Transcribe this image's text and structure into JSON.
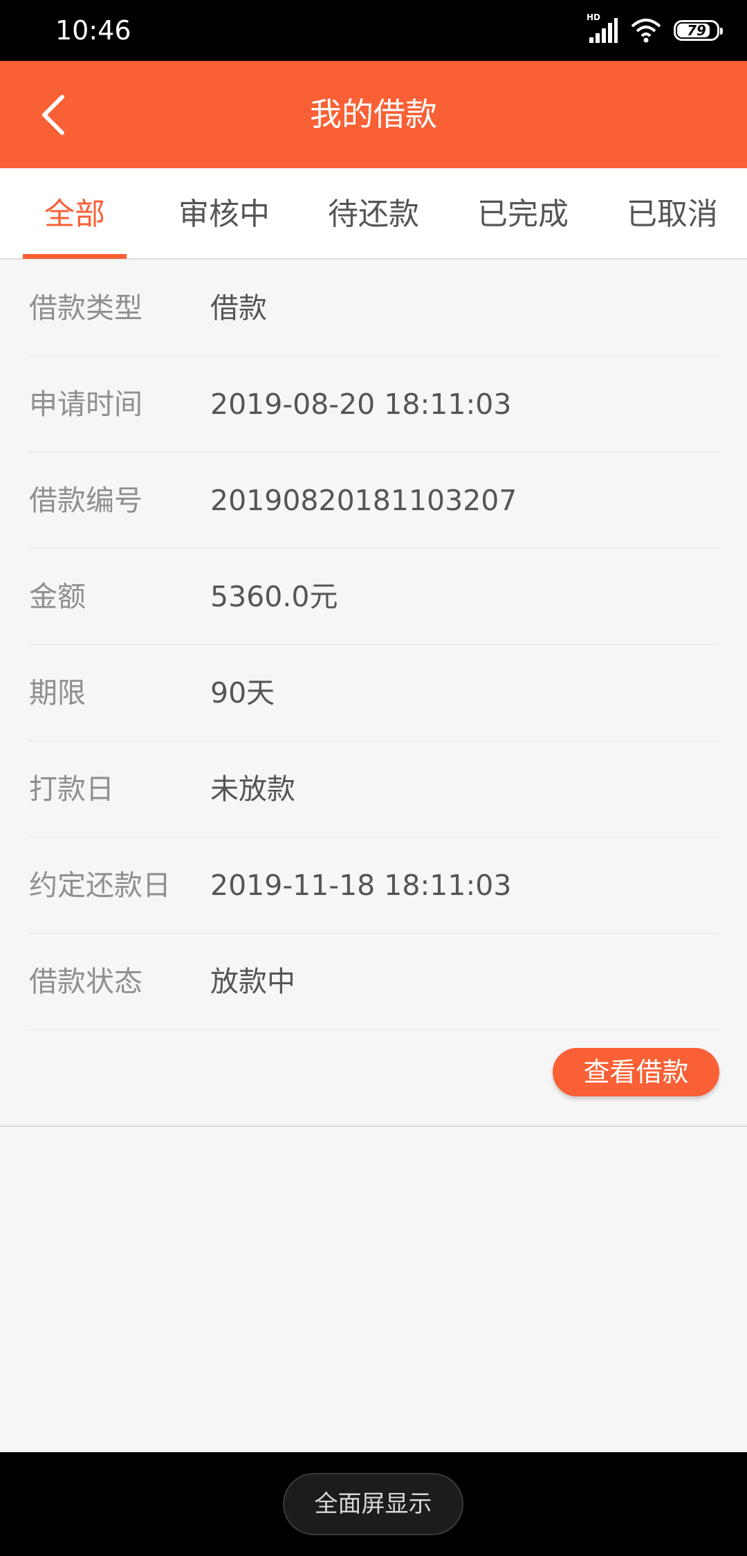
{
  "status_bar": {
    "time": "10:46",
    "network_label": "HD",
    "battery_level": "79"
  },
  "header": {
    "title": "我的借款"
  },
  "tabs": [
    {
      "label": "全部",
      "active": true
    },
    {
      "label": "审核中",
      "active": false
    },
    {
      "label": "待还款",
      "active": false
    },
    {
      "label": "已完成",
      "active": false
    },
    {
      "label": "已取消",
      "active": false
    }
  ],
  "details": [
    {
      "label": "借款类型",
      "value": "借款"
    },
    {
      "label": "申请时间",
      "value": "2019-08-20 18:11:03"
    },
    {
      "label": "借款编号",
      "value": "20190820181103207"
    },
    {
      "label": "金额",
      "value": "5360.0元"
    },
    {
      "label": "期限",
      "value": "90天"
    },
    {
      "label": "打款日",
      "value": "未放款"
    },
    {
      "label": "约定还款日",
      "value": "2019-11-18 18:11:03"
    },
    {
      "label": "借款状态",
      "value": "放款中"
    }
  ],
  "actions": {
    "view_loan_label": "查看借款"
  },
  "bottom_bar": {
    "fullscreen_label": "全面屏显示"
  },
  "colors": {
    "accent": "#f96035",
    "background": "#f6f6f6"
  }
}
